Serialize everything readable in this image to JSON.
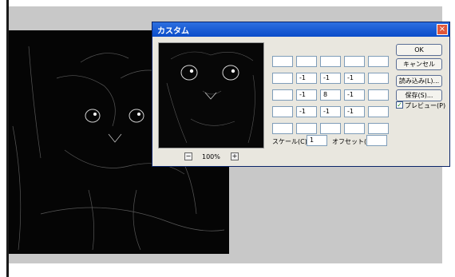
{
  "dialog": {
    "title": "カスタム",
    "close_glyph": "×",
    "zoom_minus": "−",
    "zoom_value": "100%",
    "zoom_plus": "+",
    "matrix": [
      [
        "",
        "",
        "",
        "",
        ""
      ],
      [
        "",
        "-1",
        "-1",
        "-1",
        ""
      ],
      [
        "",
        "-1",
        "8",
        "-1",
        ""
      ],
      [
        "",
        "-1",
        "-1",
        "-1",
        ""
      ],
      [
        "",
        "",
        "",
        "",
        ""
      ]
    ],
    "scale_label": "スケール(C):",
    "scale_value": "1",
    "offset_label": "オフセット(O):",
    "offset_value": "",
    "buttons": {
      "ok": "OK",
      "cancel": "キャンセル",
      "load": "読み込み(L)...",
      "save": "保存(S)..."
    },
    "preview_label": "プレビュー(P)",
    "preview_checked": "✓"
  }
}
